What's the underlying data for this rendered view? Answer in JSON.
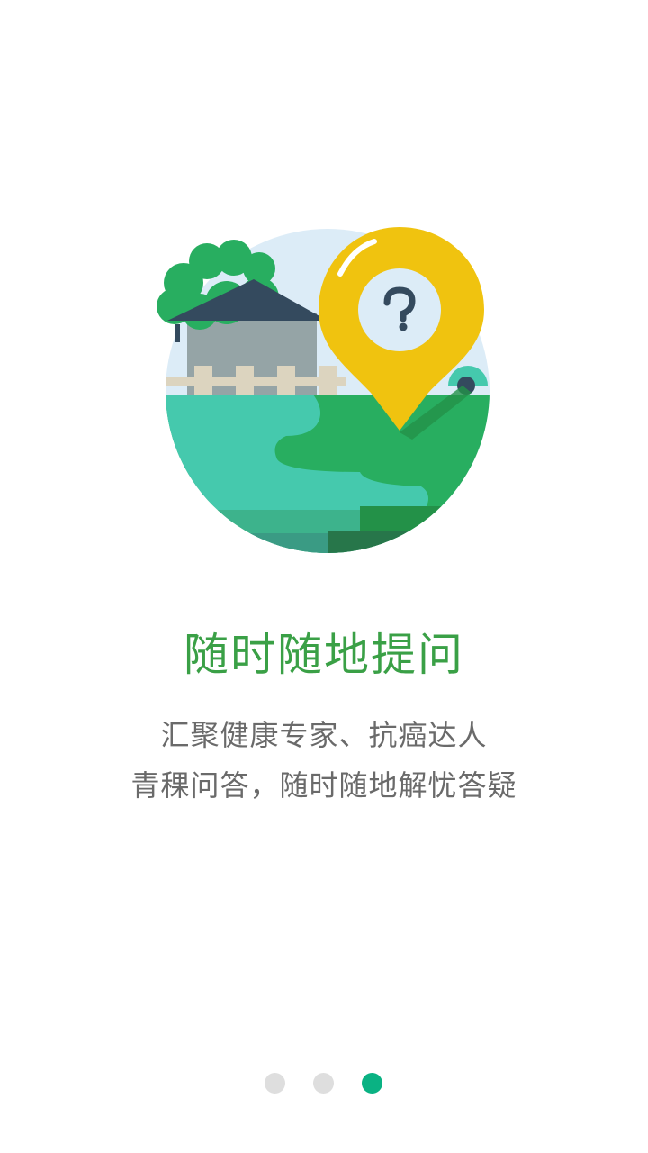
{
  "onboarding": {
    "title": "随时随地提问",
    "description_lines": [
      "汇聚健康专家、抗癌达人",
      "青稞问答，随时随地解忧答疑"
    ],
    "illustration_icon": "location-pin-question-icon",
    "page_indicator": {
      "total": 3,
      "current": 3
    }
  },
  "colors": {
    "title": "#3aa046",
    "text": "#6a6a6a",
    "dot_inactive": "#dedede",
    "dot_active": "#0ab283",
    "pin": "#f0c30f",
    "grass": "#28ae60",
    "water": "#45c9ad"
  }
}
